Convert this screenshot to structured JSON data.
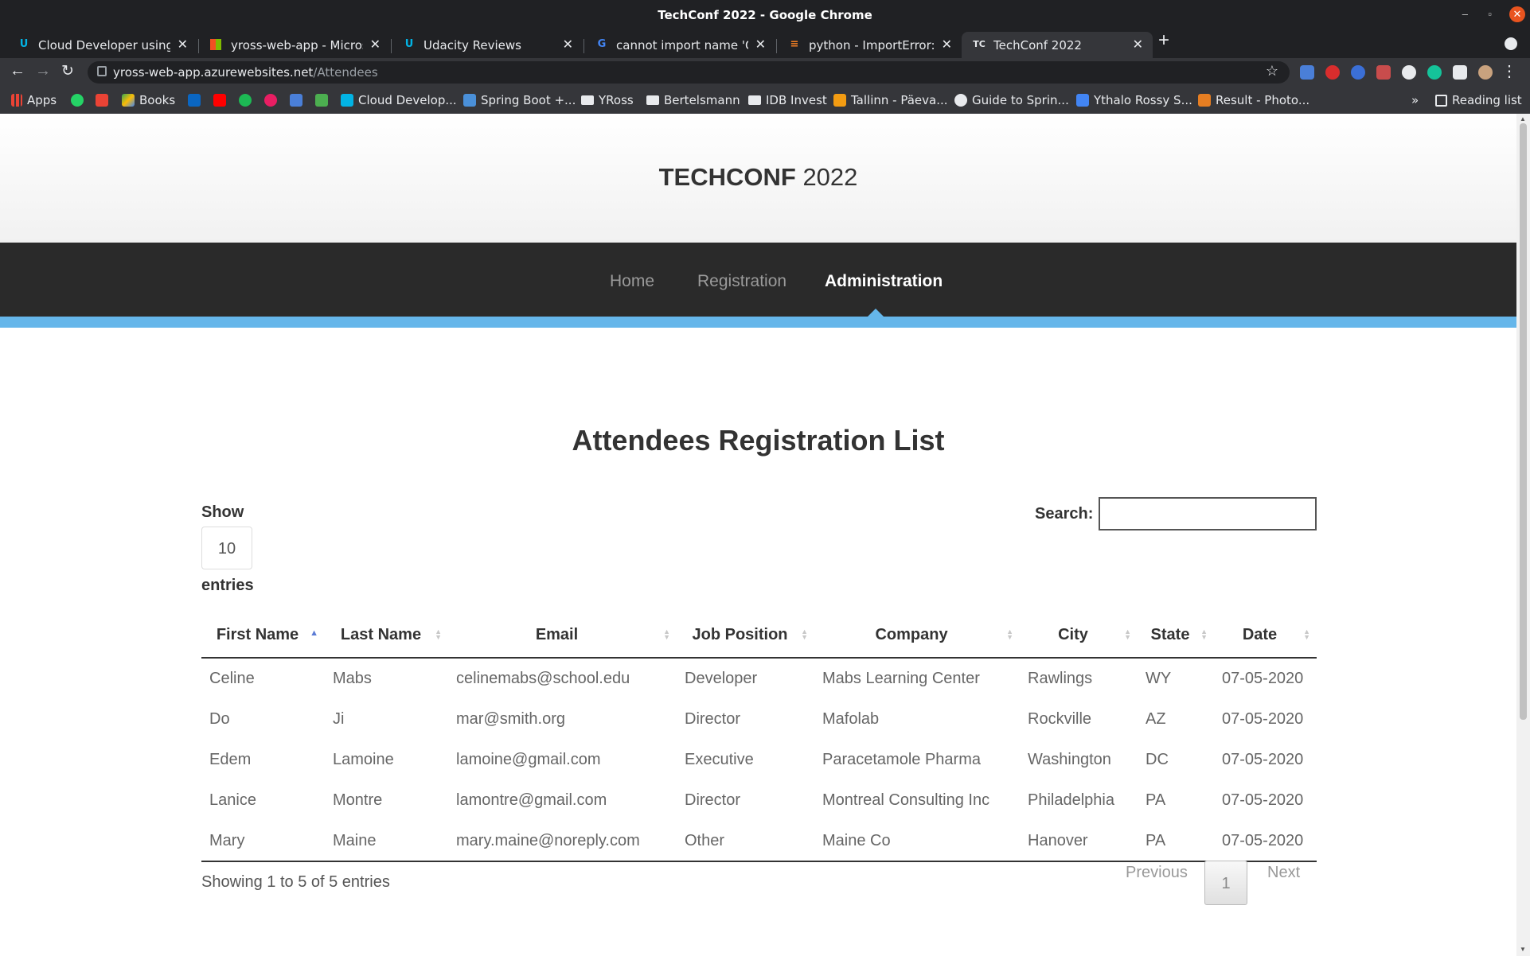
{
  "window": {
    "title": "TechConf 2022 - Google Chrome"
  },
  "tabs": [
    {
      "label": "Cloud Developer using Mi",
      "favicon": "udacity-icon"
    },
    {
      "label": "yross-web-app - Microsoft",
      "favicon": "microsoft-icon"
    },
    {
      "label": "Udacity Reviews",
      "favicon": "udacity-icon"
    },
    {
      "label": "cannot import name 'Que",
      "favicon": "google-icon"
    },
    {
      "label": "python - ImportError: can",
      "favicon": "stackoverflow-icon"
    },
    {
      "label": "TechConf 2022",
      "favicon": "techconf-icon",
      "favicon_text": "TC",
      "active": true
    }
  ],
  "address_bar": {
    "host": "yross-web-app.azurewebsites.net",
    "path": "/Attendees"
  },
  "bookmarks": {
    "apps": "Apps",
    "books": "Books",
    "cloud": "Cloud Develop...",
    "spring": "Spring Boot +...",
    "yross": "YRoss",
    "bertelsmann": "Bertelsmann",
    "idb": "IDB Invest",
    "tallinn": "Tallinn - Päeva...",
    "guide": "Guide to Sprin...",
    "ythalo": "Ythalo Rossy S...",
    "result": "Result - Photo...",
    "reading_list": "Reading list"
  },
  "site": {
    "brand_bold": "TECHCONF",
    "brand_year": "2022",
    "nav": {
      "home": "Home",
      "registration": "Registration",
      "administration": "Administration"
    },
    "heading": "Attendees Registration List",
    "show_label": "Show",
    "entries_value": "10",
    "entries_label": "entries",
    "search_label": "Search:",
    "search_value": "",
    "columns": [
      "First Name",
      "Last Name",
      "Email",
      "Job Position",
      "Company",
      "City",
      "State",
      "Date"
    ],
    "rows": [
      [
        "Celine",
        "Mabs",
        "celinemabs@school.edu",
        "Developer",
        "Mabs Learning Center",
        "Rawlings",
        "WY",
        "07-05-2020"
      ],
      [
        "Do",
        "Ji",
        "mar@smith.org",
        "Director",
        "Mafolab",
        "Rockville",
        "AZ",
        "07-05-2020"
      ],
      [
        "Edem",
        "Lamoine",
        "lamoine@gmail.com",
        "Executive",
        "Paracetamole Pharma",
        "Washington",
        "DC",
        "07-05-2020"
      ],
      [
        "Lanice",
        "Montre",
        "lamontre@gmail.com",
        "Director",
        "Montreal Consulting Inc",
        "Philadelphia",
        "PA",
        "07-05-2020"
      ],
      [
        "Mary",
        "Maine",
        "mary.maine@noreply.com",
        "Other",
        "Maine Co",
        "Hanover",
        "PA",
        "07-05-2020"
      ]
    ],
    "info": "Showing 1 to 5 of 5 entries",
    "pagination": {
      "previous": "Previous",
      "page": "1",
      "next": "Next"
    }
  },
  "colors": {
    "accent": "#65b6ea",
    "nav_bg": "#2a2a2a",
    "chrome_dark": "#202124"
  }
}
